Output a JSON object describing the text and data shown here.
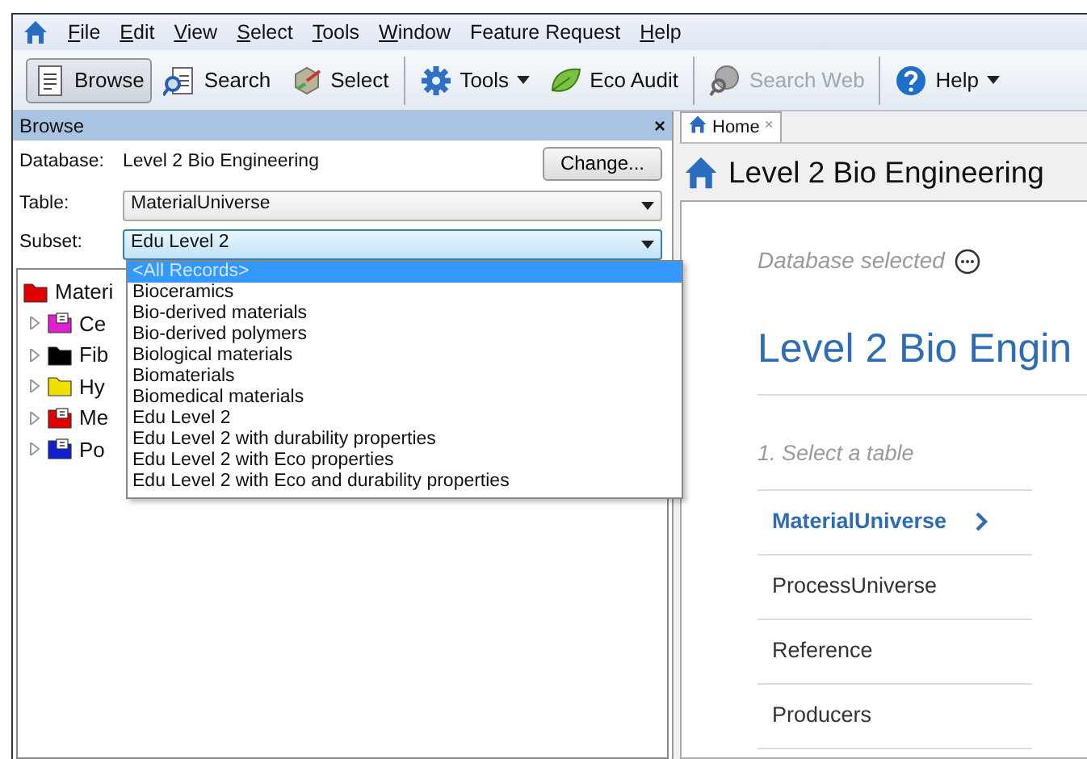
{
  "menu_bar": {
    "items": [
      {
        "label": "File",
        "mnemonic": true
      },
      {
        "label": "Edit",
        "mnemonic": true
      },
      {
        "label": "View",
        "mnemonic": true
      },
      {
        "label": "Select",
        "mnemonic": true
      },
      {
        "label": "Tools",
        "mnemonic": true
      },
      {
        "label": "Window",
        "mnemonic": true
      },
      {
        "label": "Feature Request",
        "mnemonic": false
      },
      {
        "label": "Help",
        "mnemonic": true
      }
    ]
  },
  "toolbar": {
    "groups": [
      [
        {
          "label": "Browse",
          "selected": true,
          "disabled": false,
          "dropdown": false
        },
        {
          "label": "Search",
          "selected": false,
          "disabled": false,
          "dropdown": false
        },
        {
          "label": "Select",
          "selected": false,
          "disabled": false,
          "dropdown": false
        }
      ],
      [
        {
          "label": "Tools",
          "selected": false,
          "disabled": false,
          "dropdown": true
        },
        {
          "label": "Eco Audit",
          "selected": false,
          "disabled": false,
          "dropdown": false
        }
      ],
      [
        {
          "label": "Search Web",
          "selected": false,
          "disabled": true,
          "dropdown": false
        }
      ],
      [
        {
          "label": "Help",
          "selected": false,
          "disabled": false,
          "dropdown": true
        }
      ]
    ]
  },
  "browse_panel": {
    "title": "Browse",
    "close": "×",
    "database_label": "Database:",
    "database_value": "Level 2 Bio Engineering",
    "change_button": "Change...",
    "fields": [
      {
        "label": "Table:",
        "value": "MaterialUniverse",
        "focused": false
      },
      {
        "label": "Subset:",
        "value": "Edu Level 2",
        "focused": true
      }
    ],
    "subset_options": [
      {
        "label": "<All Records>",
        "selected": true
      },
      {
        "label": "Bioceramics",
        "selected": false
      },
      {
        "label": "Bio-derived materials",
        "selected": false
      },
      {
        "label": "Bio-derived polymers",
        "selected": false
      },
      {
        "label": "Biological materials",
        "selected": false
      },
      {
        "label": "Biomaterials",
        "selected": false
      },
      {
        "label": "Biomedical materials",
        "selected": false
      },
      {
        "label": "Edu Level 2",
        "selected": false
      },
      {
        "label": "Edu Level 2 with durability properties",
        "selected": false
      },
      {
        "label": "Edu Level 2 with Eco  properties",
        "selected": false
      },
      {
        "label": "Edu Level 2 with Eco and durability properties",
        "selected": false
      }
    ],
    "tree": [
      {
        "label": "Materi",
        "kind": "folder",
        "color": "#e00000",
        "children": [
          {
            "label": "Ce",
            "kind": "records",
            "color": "#e020d0",
            "expanded": false
          },
          {
            "label": "Fib",
            "kind": "folder",
            "color": "#000000",
            "expanded": false
          },
          {
            "label": "Hy",
            "kind": "folder",
            "color": "#f0e000",
            "expanded": false
          },
          {
            "label": "Me",
            "kind": "records",
            "color": "#e00000",
            "expanded": false
          },
          {
            "label": "Po",
            "kind": "records",
            "color": "#1020d0",
            "expanded": false
          }
        ]
      }
    ]
  },
  "home_panel": {
    "tabs": [
      {
        "label": "Home",
        "selected": true,
        "close": "×"
      }
    ],
    "title": "Level 2 Bio Engineering",
    "status": "Database selected",
    "heading": "Level 2 Bio Engin",
    "step": "1. Select a table",
    "tables": [
      {
        "label": "MaterialUniverse",
        "selected": true
      },
      {
        "label": "ProcessUniverse",
        "selected": false
      },
      {
        "label": "Reference",
        "selected": false
      },
      {
        "label": "Producers",
        "selected": false
      }
    ]
  }
}
